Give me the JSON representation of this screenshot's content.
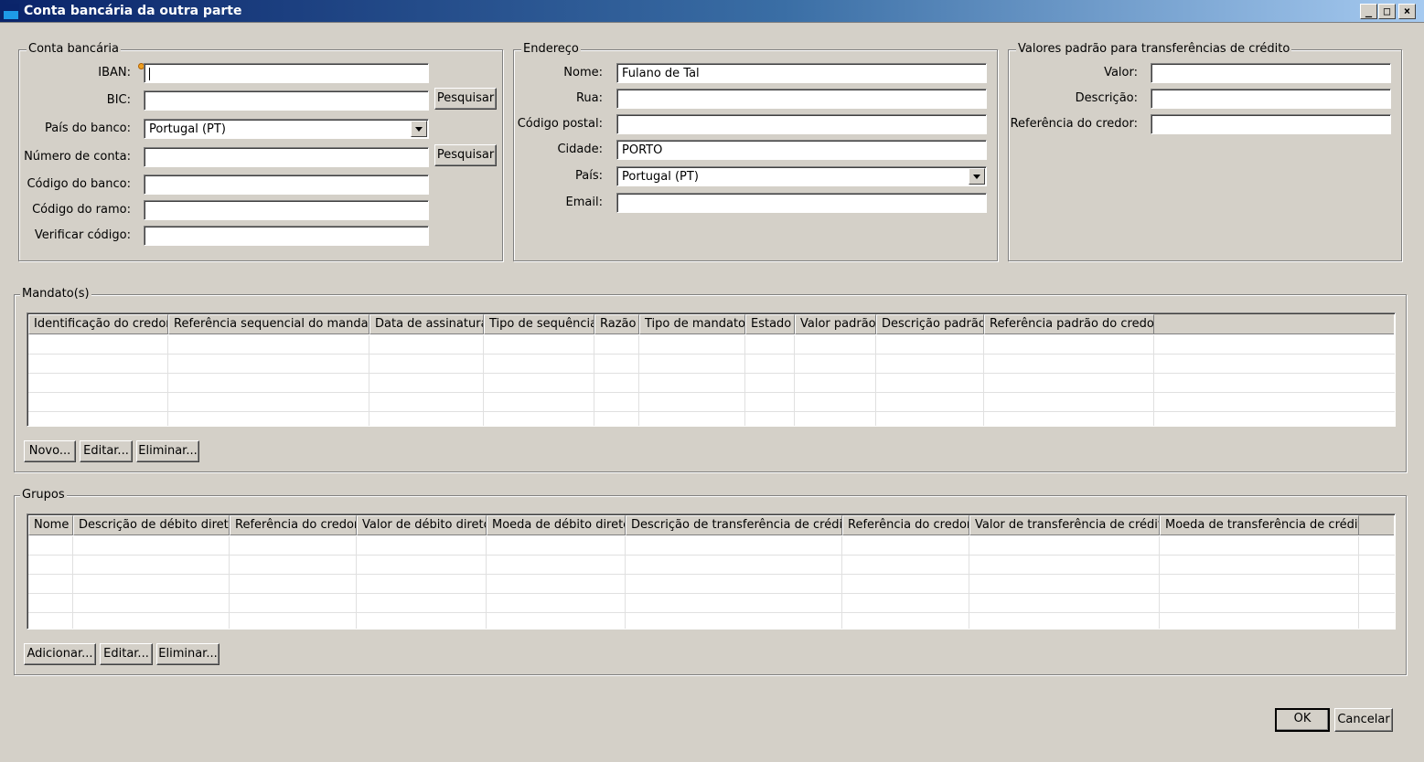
{
  "window": {
    "title": "Conta bancária da outra parte",
    "minimize": "_",
    "maximize": "□",
    "close": "×"
  },
  "conta": {
    "legend": "Conta bancária",
    "iban_label": "IBAN:",
    "iban_value": "",
    "bic_label": "BIC:",
    "bic_value": "",
    "pesquisar_bic": "Pesquisar",
    "pais_label": "País do banco:",
    "pais_value": "Portugal (PT)",
    "numero_label": "Número de conta:",
    "numero_value": "",
    "pesquisar_numero": "Pesquisar",
    "codigo_banco_label": "Código do banco:",
    "codigo_banco_value": "",
    "codigo_ramo_label": "Código do ramo:",
    "codigo_ramo_value": "",
    "verificar_label": "Verificar código:",
    "verificar_value": ""
  },
  "endereco": {
    "legend": "Endereço",
    "nome_label": "Nome:",
    "nome_value": "Fulano de Tal",
    "rua_label": "Rua:",
    "rua_value": "",
    "postal_label": "Código postal:",
    "postal_value": "",
    "cidade_label": "Cidade:",
    "cidade_value": "PORTO",
    "pais_label": "País:",
    "pais_value": "Portugal (PT)",
    "email_label": "Email:",
    "email_value": ""
  },
  "valores": {
    "legend": "Valores padrão para transferências de crédito",
    "valor_label": "Valor:",
    "valor_value": "",
    "descricao_label": "Descrição:",
    "descricao_value": "",
    "referencia_label": "Referência do credor:",
    "referencia_value": ""
  },
  "mandatos": {
    "legend": "Mandato(s)",
    "columns": [
      "Identificação do credor",
      "Referência sequencial do mandato",
      "Data de assinatura",
      "Tipo de sequência",
      "Razão",
      "Tipo de mandato",
      "Estado",
      "Valor padrão",
      "Descrição padrão",
      "Referência padrão do credor"
    ],
    "novo": "Novo...",
    "editar": "Editar...",
    "eliminar": "Eliminar..."
  },
  "grupos": {
    "legend": "Grupos",
    "columns": [
      "Nome",
      "Descrição de débito direto",
      "Referência do credor",
      "Valor de débito direto",
      "Moeda de débito direto",
      "Descrição de transferência de crédito",
      "Referência do credor",
      "Valor de transferência de crédito",
      "Moeda de transferência de crédito"
    ],
    "adicionar": "Adicionar...",
    "editar": "Editar...",
    "eliminar": "Eliminar..."
  },
  "footer": {
    "ok": "OK",
    "cancelar": "Cancelar"
  }
}
